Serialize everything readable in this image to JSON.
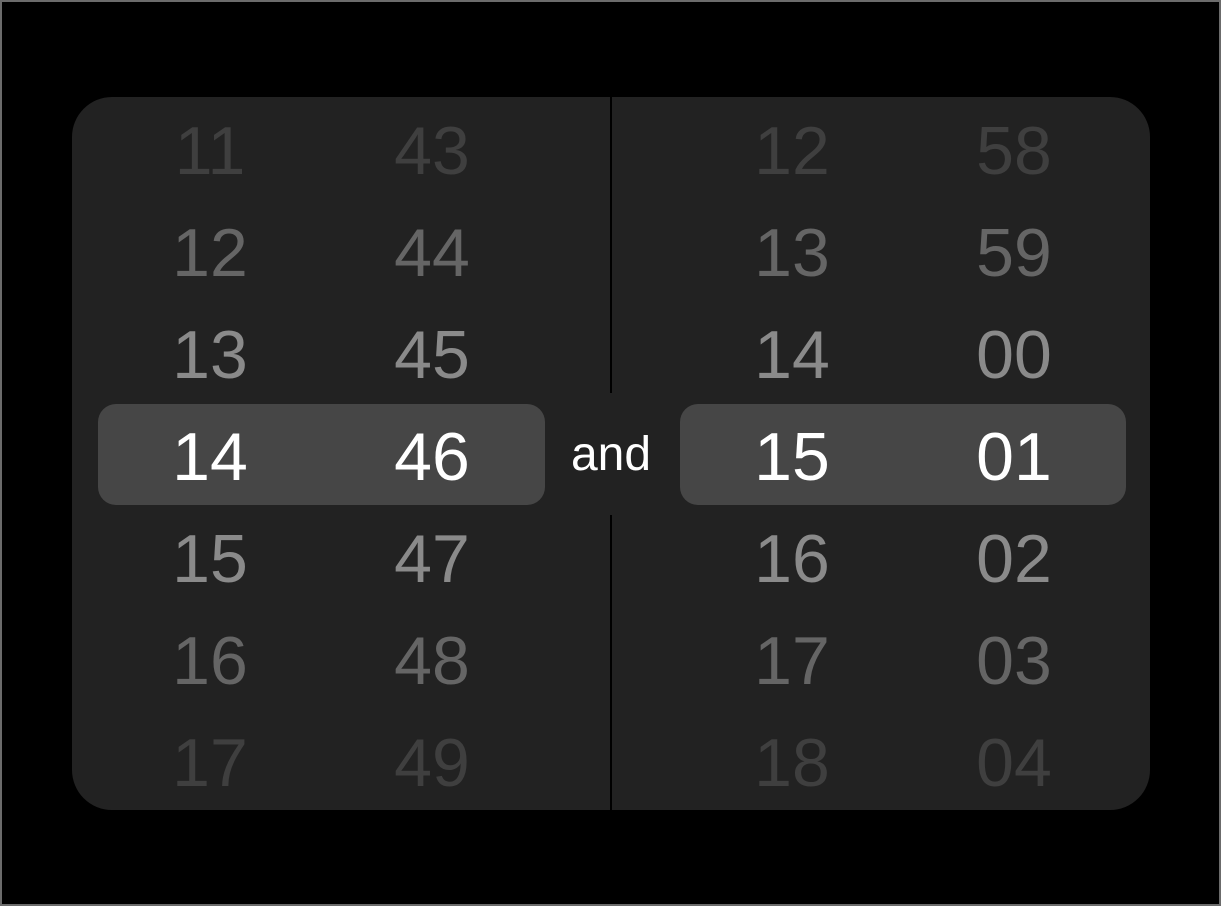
{
  "separator_label": "and",
  "colors": {
    "background": "#000000",
    "card": "#222222",
    "selection": "#464646",
    "selected_text": "#ffffff"
  },
  "pickers": [
    {
      "name": "start-time",
      "hours": [
        "11",
        "12",
        "13",
        "14",
        "15",
        "16",
        "17"
      ],
      "minutes": [
        "43",
        "44",
        "45",
        "46",
        "47",
        "48",
        "49"
      ],
      "selected_hour": "14",
      "selected_minute": "46"
    },
    {
      "name": "end-time",
      "hours": [
        "12",
        "13",
        "14",
        "15",
        "16",
        "17",
        "18"
      ],
      "minutes": [
        "58",
        "59",
        "00",
        "01",
        "02",
        "03",
        "04"
      ],
      "selected_hour": "15",
      "selected_minute": "01"
    }
  ]
}
